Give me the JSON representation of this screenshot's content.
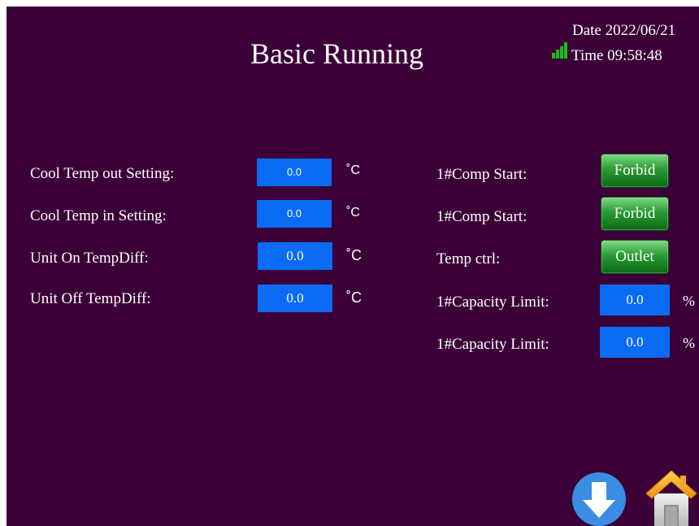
{
  "header": {
    "title": "Basic Running",
    "date_text": "Date 2022/06/21",
    "time_text": "Time 09:58:48",
    "signal_icon": "signal-bars-icon",
    "signal_color": "#17c21a"
  },
  "left_settings": [
    {
      "label": "Cool Temp out Setting:",
      "value": "0.0",
      "unit": "˚C"
    },
    {
      "label": "Cool Temp in Setting:",
      "value": "0.0",
      "unit": "˚C"
    },
    {
      "label": "Unit On TempDiff:",
      "value": "0.0",
      "unit": "˚C"
    },
    {
      "label": "Unit Off TempDiff:",
      "value": "0.0",
      "unit": "˚C"
    }
  ],
  "right_settings": [
    {
      "label": "1#Comp Start:",
      "button": "Forbid"
    },
    {
      "label": "1#Comp Start:",
      "button": "Forbid"
    },
    {
      "label": "Temp ctrl:",
      "button": "Outlet"
    },
    {
      "label": "1#Capacity Limit:",
      "value": "0.0",
      "unit": "%"
    },
    {
      "label": "1#Capacity Limit:",
      "value": "0.0",
      "unit": "%"
    }
  ],
  "nav": {
    "down_icon": "arrow-down-icon",
    "home_icon": "home-icon"
  },
  "colors": {
    "background": "#3c0038",
    "input_box": "#0a6cf5",
    "button_green": "#2a9b34",
    "nav_blue": "#3a8de3"
  }
}
